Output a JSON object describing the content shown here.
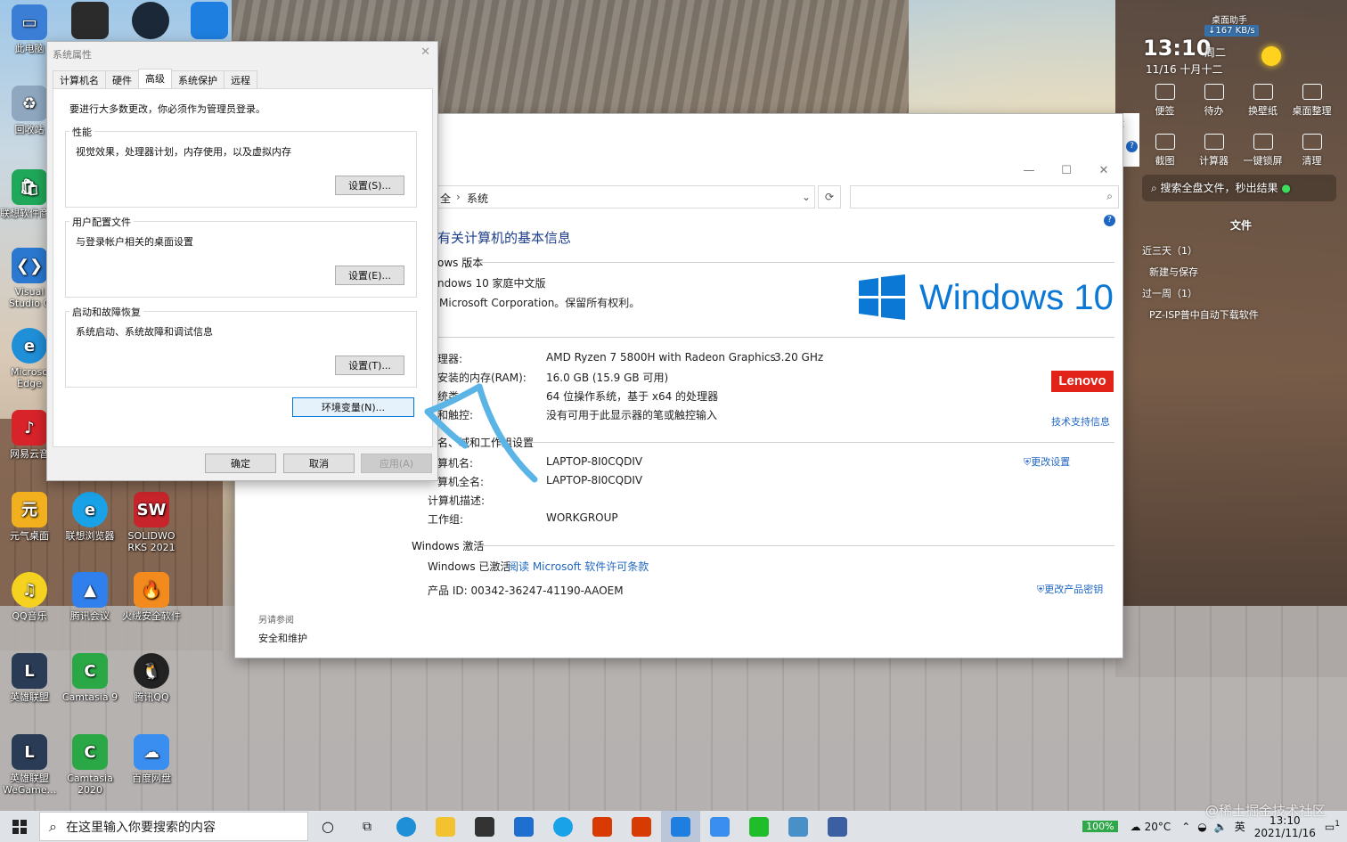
{
  "desktop_icons": [
    {
      "label": "此电脑",
      "color": "#3b7ed6"
    },
    {
      "label": "回收站",
      "color": "#8fa8c0"
    },
    {
      "label": "联想软件商店",
      "color": "#1fa85a",
      "badge": "5"
    },
    {
      "label": "Visual Studio C",
      "color": "#2a78d0"
    },
    {
      "label": "Microso Edge",
      "color": "#1f8fd8"
    },
    {
      "label": "网易云音",
      "color": "#d8232a"
    },
    {
      "label": "元气桌面",
      "color": "#f2b01e"
    },
    {
      "label": "联想浏览器",
      "color": "#1aa2e8"
    },
    {
      "label": "SOLIDWO RKS 2021",
      "color": "#c8242b"
    },
    {
      "label": "QQ音乐",
      "color": "#f5d21f"
    },
    {
      "label": "腾讯会议",
      "color": "#2f80ed"
    },
    {
      "label": "火绒安全软件",
      "color": "#f28a1e"
    },
    {
      "label": "英雄联盟",
      "color": "#2a3b55"
    },
    {
      "label": "Camtasia 9",
      "color": "#2aa845"
    },
    {
      "label": "腾讯QQ",
      "color": "#222222"
    },
    {
      "label": "英雄联盟 WeGame...",
      "color": "#2a3b55"
    },
    {
      "label": "Camtasia 2020",
      "color": "#2aa845"
    },
    {
      "label": "百度网盘",
      "color": "#3a8ef0"
    }
  ],
  "top_icons": [
    {
      "color": "#2b2b2b"
    },
    {
      "color": "#1b2838"
    },
    {
      "color": "#1f7fe0"
    }
  ],
  "sysinfo": {
    "breadcrumb_prefix": "全",
    "breadcrumb_sep": "›",
    "breadcrumb_current": "系统",
    "header": "有关计算机的基本信息",
    "edition_section": "ows 版本",
    "edition": "ndows 10 家庭中文版",
    "copyright": "Microsoft Corporation。保留所有权利。",
    "win10_logo": "Windows 10",
    "rows": [
      {
        "k": "理器:",
        "v": "AMD Ryzen 7 5800H with Radeon Graphics",
        "extra": "3.20 GHz"
      },
      {
        "k": "安装的内存(RAM):",
        "v": "16.0 GB (15.9 GB 可用)"
      },
      {
        "k": "统类",
        "v": "64 位操作系统，基于 x64 的处理器"
      },
      {
        "k": "和触控:",
        "v": "没有可用于此显示器的笔或触控输入"
      }
    ],
    "lenovo": "Lenovo",
    "support_link": "技术支持信息",
    "name_section": "名、域和工作组设置",
    "name_rows": [
      {
        "k": "算机名:",
        "v": "LAPTOP-8I0CQDIV"
      },
      {
        "k": "算机全名:",
        "v": "LAPTOP-8I0CQDIV"
      },
      {
        "k": "计算机描述:",
        "v": ""
      },
      {
        "k": "工作组:",
        "v": "WORKGROUP"
      }
    ],
    "change_settings": "更改设置",
    "activation_section": "Windows 激活",
    "activated": "Windows 已激活",
    "license_link": "阅读 Microsoft 软件许可条款",
    "product_id": "产品 ID: 00342-36247-41190-AAOEM",
    "change_key": "更改产品密钥",
    "see_also": "另请参阅",
    "security": "安全和维护"
  },
  "sysprop": {
    "title": "系统属性",
    "tabs": [
      "计算机名",
      "硬件",
      "高级",
      "系统保护",
      "远程"
    ],
    "admin_note": "要进行大多数更改，你必须作为管理员登录。",
    "perf_title": "性能",
    "perf_desc": "视觉效果，处理器计划，内存使用，以及虚拟内存",
    "perf_btn": "设置(S)...",
    "profile_title": "用户配置文件",
    "profile_desc": "与登录帐户相关的桌面设置",
    "profile_btn": "设置(E)...",
    "startup_title": "启动和故障恢复",
    "startup_desc": "系统启动、系统故障和调试信息",
    "startup_btn": "设置(T)...",
    "env_btn": "环境变量(N)...",
    "ok": "确定",
    "cancel": "取消",
    "apply": "应用(A)"
  },
  "widget": {
    "title": "桌面助手",
    "speed": "↓167 KB/s",
    "time": "13:10",
    "weekday": "周二",
    "date": "11/16 十月十二",
    "items": [
      "便签",
      "待办",
      "换壁纸",
      "桌面整理",
      "截图",
      "计算器",
      "一键锁屏",
      "清理"
    ],
    "search": "搜索全盘文件，秒出结果",
    "files_header": "文件",
    "recent3": "近三天（1）",
    "recent3_item": "新建与保存",
    "recent7": "过一周（1）",
    "recent7_item": "PZ-ISP普中自动下载软件"
  },
  "taskbar": {
    "search_placeholder": "在这里输入你要搜索的内容",
    "apps": [
      {
        "name": "edge",
        "color": "#1f8fd8"
      },
      {
        "name": "explorer",
        "color": "#f2c230"
      },
      {
        "name": "store",
        "color": "#333333"
      },
      {
        "name": "mail",
        "color": "#1f6fd0"
      },
      {
        "name": "lenovo-browser",
        "color": "#1aa2e8"
      },
      {
        "name": "office",
        "color": "#d83b01"
      },
      {
        "name": "wps",
        "color": "#d83b01"
      },
      {
        "name": "app-blue",
        "color": "#1f7fe0"
      },
      {
        "name": "baidu",
        "color": "#3a8ef0"
      },
      {
        "name": "wechat",
        "color": "#1fbd2a"
      },
      {
        "name": "control",
        "color": "#4a90c8"
      },
      {
        "name": "system",
        "color": "#3b5fa0"
      }
    ],
    "battery": "100%",
    "weather": "20°C",
    "ime": "英",
    "time": "13:10",
    "date": "2021/11/16",
    "notif": "1"
  },
  "watermark": "@稀土掘金技术社区"
}
